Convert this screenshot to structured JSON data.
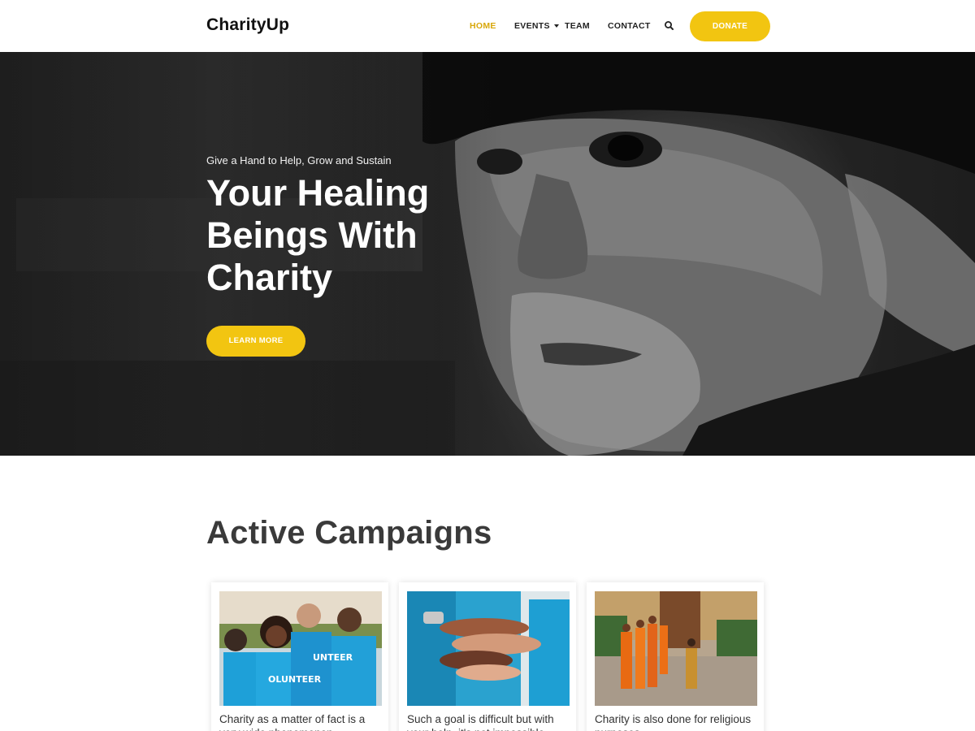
{
  "header": {
    "logo": "CharityUp",
    "nav": [
      {
        "label": "HOME",
        "active": true
      },
      {
        "label": "EVENTS",
        "active": false,
        "has_dropdown": true
      },
      {
        "label": "TEAM",
        "active": false
      },
      {
        "label": "CONTACT",
        "active": false
      }
    ],
    "search_icon": "search-icon",
    "donate_label": "DONATE"
  },
  "hero": {
    "subtitle": "Give a Hand to Help, Grow and Sustain",
    "title": "Your Healing Beings With Charity",
    "button_label": "LEARN MORE"
  },
  "campaigns": {
    "title": "Active Campaigns",
    "cards": [
      {
        "text": "Charity as a matter of fact is a very wide phenomenon"
      },
      {
        "text": "Such a goal is difficult but with your help, it's not impossible"
      },
      {
        "text": "Charity is also done for religious purposes"
      }
    ]
  },
  "colors": {
    "accent": "#f2c511",
    "active_nav": "#d8a70a",
    "heading": "#3a3a3a"
  }
}
